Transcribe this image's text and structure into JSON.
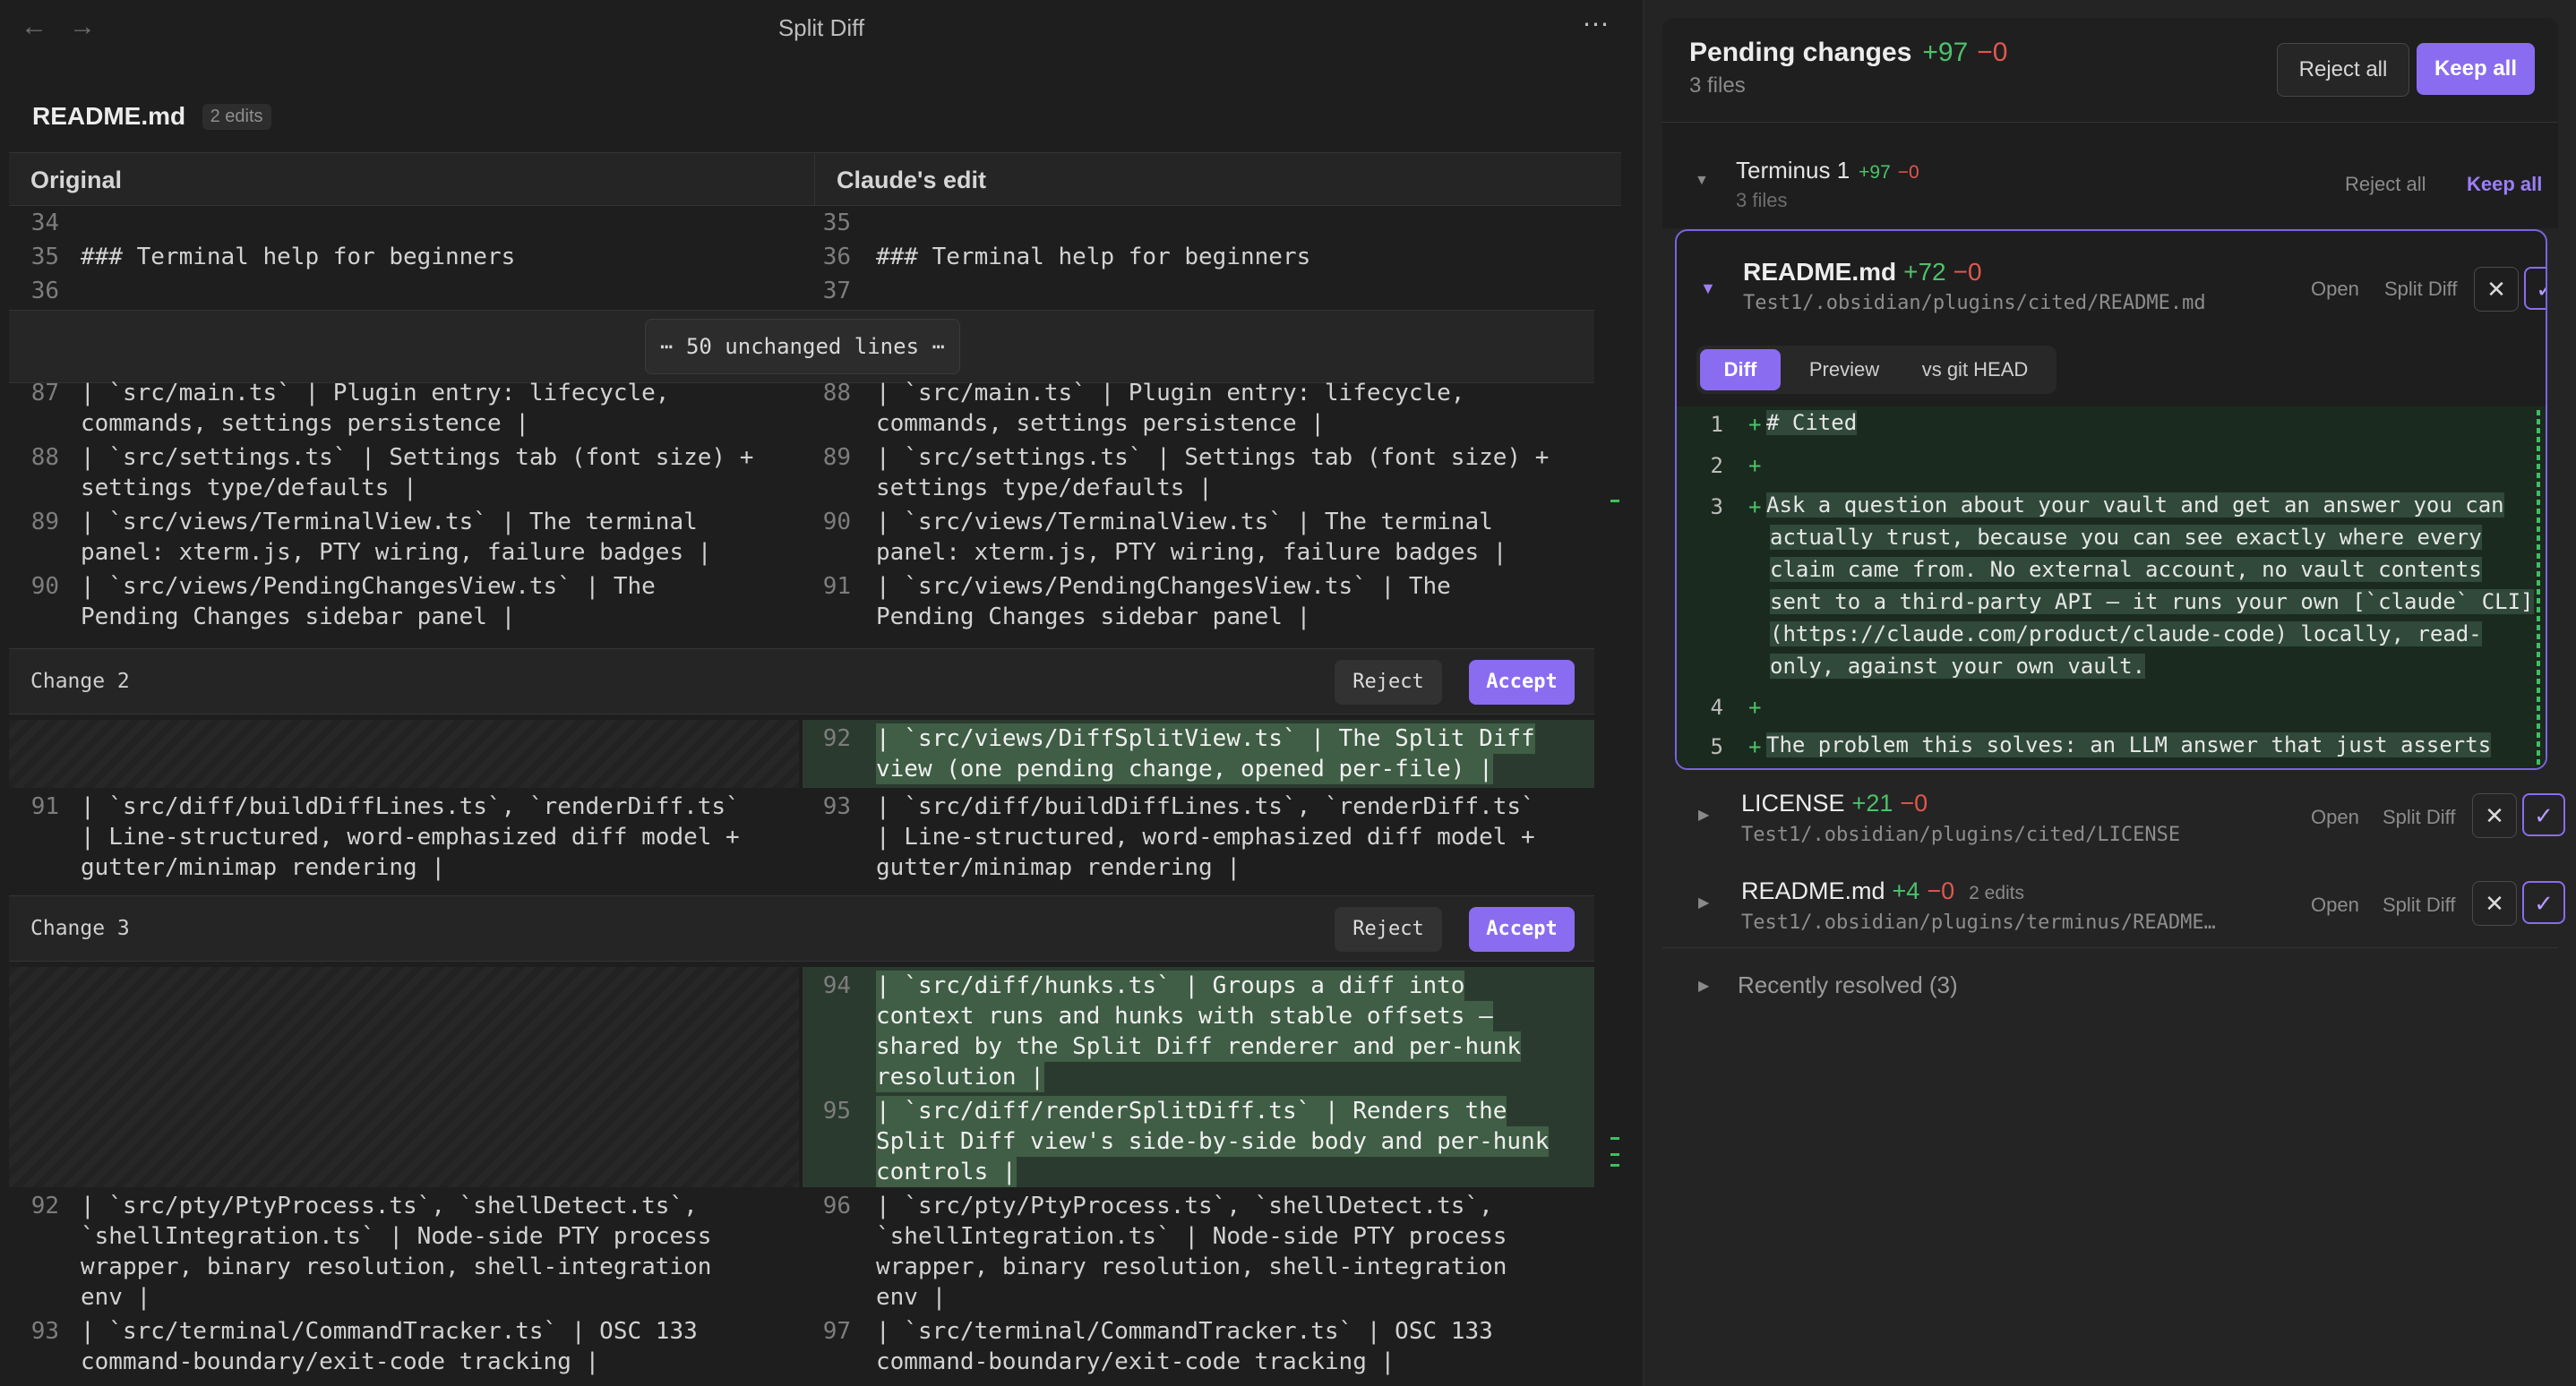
{
  "window": {
    "title": "Split Diff"
  },
  "file": {
    "name": "README.md",
    "edits": "2 edits"
  },
  "columns": {
    "original": "Original",
    "edited": "Claude's edit"
  },
  "context_top": {
    "left": [
      {
        "n": "34",
        "t": ""
      },
      {
        "n": "35",
        "t": "### Terminal help for beginners"
      },
      {
        "n": "36",
        "t": ""
      }
    ],
    "right": [
      {
        "n": "35",
        "t": ""
      },
      {
        "n": "36",
        "t": "### Terminal help for beginners"
      },
      {
        "n": "37",
        "t": ""
      }
    ]
  },
  "unchanged": {
    "label": "⋯ 50 unchanged lines ⋯"
  },
  "block1": {
    "left": [
      {
        "n": "87",
        "l1": "| `src/main.ts` | Plugin entry: lifecycle,",
        "l2": "commands, settings persistence |"
      },
      {
        "n": "88",
        "l1": "| `src/settings.ts` | Settings tab (font size) +",
        "l2": "settings type/defaults |"
      },
      {
        "n": "89",
        "l1": "| `src/views/TerminalView.ts` | The terminal",
        "l2": "panel: xterm.js, PTY wiring, failure badges |"
      },
      {
        "n": "90",
        "l1": "| `src/views/PendingChangesView.ts` | The",
        "l2": "Pending Changes sidebar panel |"
      }
    ],
    "right": [
      {
        "n": "88",
        "l1": "| `src/main.ts` | Plugin entry: lifecycle,",
        "l2": "commands, settings persistence |"
      },
      {
        "n": "89",
        "l1": "| `src/settings.ts` | Settings tab (font size) +",
        "l2": "settings type/defaults |"
      },
      {
        "n": "90",
        "l1": "| `src/views/TerminalView.ts` | The terminal",
        "l2": "panel: xterm.js, PTY wiring, failure badges |"
      },
      {
        "n": "91",
        "l1": "| `src/views/PendingChangesView.ts` | The",
        "l2": "Pending Changes sidebar panel |"
      }
    ]
  },
  "change2": {
    "label": "Change 2",
    "reject": "Reject",
    "accept": "Accept",
    "added": {
      "n": "92",
      "l1": "| `src/views/DiffSplitView.ts` | The Split Diff",
      "l2": "view (one pending change, opened per-file) |"
    },
    "left": {
      "n": "91",
      "l1": "| `src/diff/buildDiffLines.ts`, `renderDiff.ts`",
      "l2": "| Line-structured, word-emphasized diff model +",
      "l3": "gutter/minimap rendering |"
    },
    "right": {
      "n": "93",
      "l1": "| `src/diff/buildDiffLines.ts`, `renderDiff.ts`",
      "l2": "| Line-structured, word-emphasized diff model +",
      "l3": "gutter/minimap rendering |"
    }
  },
  "change3": {
    "label": "Change 3",
    "reject": "Reject",
    "accept": "Accept",
    "added1": {
      "n": "94",
      "l1": "| `src/diff/hunks.ts` | Groups a diff into",
      "l2": "context runs and hunks with stable offsets —",
      "l3": "shared by the Split Diff renderer and per-hunk",
      "l4": "resolution |"
    },
    "added2": {
      "n": "95",
      "l1": "| `src/diff/renderSplitDiff.ts` | Renders the",
      "l2": "Split Diff view's side-by-side body and per-hunk",
      "l3": "controls |"
    },
    "left": [
      {
        "n": "92",
        "l1": "| `src/pty/PtyProcess.ts`, `shellDetect.ts`,",
        "l2": "`shellIntegration.ts` | Node-side PTY process",
        "l3": "wrapper, binary resolution, shell-integration",
        "l4": "env |"
      },
      {
        "n": "93",
        "l1": "| `src/terminal/CommandTracker.ts` | OSC 133",
        "l2": "command-boundary/exit-code tracking |"
      }
    ],
    "right": [
      {
        "n": "96",
        "l1": "| `src/pty/PtyProcess.ts`, `shellDetect.ts`,",
        "l2": "`shellIntegration.ts` | Node-side PTY process",
        "l3": "wrapper, binary resolution, shell-integration",
        "l4": "env |"
      },
      {
        "n": "97",
        "l1": "| `src/terminal/CommandTracker.ts` | OSC 133",
        "l2": "command-boundary/exit-code tracking |"
      }
    ]
  },
  "pending": {
    "title": "Pending changes",
    "add": "+97",
    "del": "−0",
    "files": "3 files",
    "reject_all": "Reject all",
    "keep_all": "Keep all",
    "group": {
      "title": "Terminus 1",
      "add": "+97",
      "del": "−0",
      "files": "3 files",
      "reject_all": "Reject all",
      "keep_all": "Keep all"
    },
    "card": {
      "name": "README.md",
      "add": "+72",
      "del": "−0",
      "path": "Test1/.obsidian/plugins/cited/README.md",
      "open": "Open",
      "split": "Split Diff",
      "tabs": [
        "Diff",
        "Preview",
        "vs git HEAD"
      ],
      "lines": [
        {
          "n": "1",
          "t": [
            "# Cited"
          ]
        },
        {
          "n": "2",
          "t": [
            ""
          ]
        },
        {
          "n": "3",
          "t": [
            "Ask a question about your vault and get an answer you can",
            "actually trust, because you can see exactly where every",
            "claim came from. No external account, no vault contents",
            "sent to a third-party API — it runs your own [`claude` CLI]",
            "(https://claude.com/product/claude-code) locally, read-",
            "only, against your own vault."
          ]
        },
        {
          "n": "4",
          "t": [
            ""
          ]
        },
        {
          "n": "5",
          "t": [
            "The problem this solves: an LLM answer that just asserts"
          ]
        }
      ]
    },
    "files_list": [
      {
        "name": "LICENSE",
        "add": "+21",
        "del": "−0",
        "edits": "",
        "path": "Test1/.obsidian/plugins/cited/LICENSE",
        "open": "Open",
        "split": "Split Diff"
      },
      {
        "name": "README.md",
        "add": "+4",
        "del": "−0",
        "edits": "2 edits",
        "path": "Test1/.obsidian/plugins/terminus/README…",
        "open": "Open",
        "split": "Split Diff"
      }
    ],
    "recent": "Recently resolved (3)"
  },
  "colors": {
    "accent": "#8a6cf0",
    "added": "#4cc26a",
    "removed": "#e0574f"
  },
  "icons": {
    "back": "arrow-left-icon",
    "forward": "arrow-right-icon",
    "more": "more-icon",
    "reject": "x-icon",
    "keep": "check-icon"
  }
}
